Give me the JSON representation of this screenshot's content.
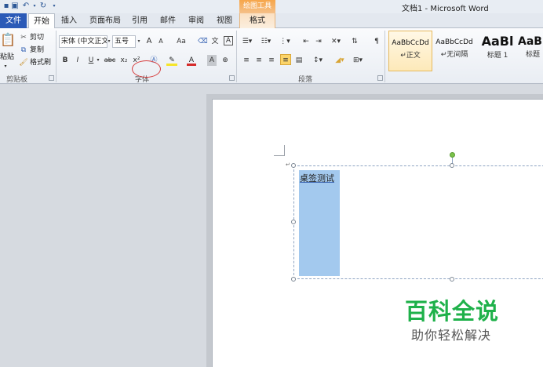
{
  "window": {
    "title": "文档1 - Microsoft Word"
  },
  "context_tab_group": {
    "label": "绘图工具"
  },
  "tabs": [
    {
      "label": "文件"
    },
    {
      "label": "开始"
    },
    {
      "label": "插入"
    },
    {
      "label": "页面布局"
    },
    {
      "label": "引用"
    },
    {
      "label": "邮件"
    },
    {
      "label": "审阅"
    },
    {
      "label": "视图"
    },
    {
      "label": "格式"
    }
  ],
  "clipboard": {
    "group_label": "剪贴板",
    "paste_label": "粘贴",
    "cut_label": "剪切",
    "copy_label": "复制",
    "format_painter_label": "格式刷"
  },
  "font": {
    "group_label": "字体",
    "font_name": "宋体 (中文正文)",
    "font_size": "五号",
    "grow_label": "A",
    "shrink_label": "A",
    "case_label": "Aa",
    "clear_label": "A",
    "bold": "B",
    "italic": "I",
    "underline": "U",
    "strike": "abc",
    "subscript": "x₂",
    "superscript": "x²",
    "font_color_label": "A",
    "char_shading_label": "A"
  },
  "paragraph": {
    "group_label": "段落"
  },
  "styles": {
    "items": [
      {
        "preview": "AaBbCcDd",
        "name": "↵正文"
      },
      {
        "preview": "AaBbCcDd",
        "name": "↵无间隔"
      },
      {
        "preview": "AaBl",
        "name": "标题 1"
      },
      {
        "preview": "AaB",
        "name": "标题"
      }
    ]
  },
  "document": {
    "textbox_text": "桌签测试"
  },
  "watermark": {
    "title": "百科全说",
    "subtitle": "助你轻松解决"
  },
  "colors": {
    "file_tab": "#2b5ab7",
    "context_tab": "#f6a64a",
    "selection": "#a3c9ee",
    "watermark_green": "#1fb14a"
  }
}
